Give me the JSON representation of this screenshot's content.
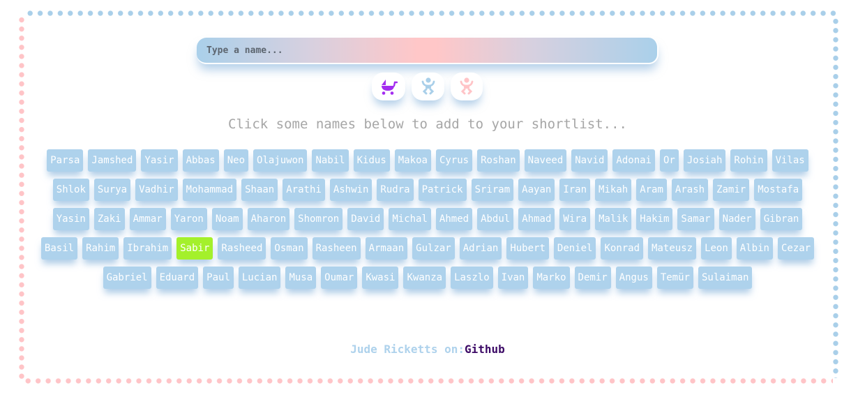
{
  "search": {
    "placeholder": "Type a name...",
    "value": ""
  },
  "gender_filters": [
    {
      "icon": "stroller-icon",
      "label": "All",
      "color": "#a32cf0"
    },
    {
      "icon": "baby-boy-icon",
      "label": "Boy",
      "color": "#a9cfe9"
    },
    {
      "icon": "baby-girl-icon",
      "label": "Girl",
      "color": "#ffc4c7"
    }
  ],
  "hint": "Click some names below to add to your shortlist...",
  "names": [
    "Parsa",
    "Jamshed",
    "Yasir",
    "Abbas",
    "Neo",
    "Olajuwon",
    "Nabil",
    "Kidus",
    "Makoa",
    "Cyrus",
    "Roshan",
    "Naveed",
    "Navid",
    "Adonai",
    "Or",
    "Josiah",
    "Rohin",
    "Vilas",
    "Shlok",
    "Surya",
    "Vadhir",
    "Mohammad",
    "Shaan",
    "Arathi",
    "Ashwin",
    "Rudra",
    "Patrick",
    "Sriram",
    "Aayan",
    "Iran",
    "Mikah",
    "Aram",
    "Arash",
    "Zamir",
    "Mostafa",
    "Yasin",
    "Zaki",
    "Ammar",
    "Yaron",
    "Noam",
    "Aharon",
    "Shomron",
    "David",
    "Michal",
    "Ahmed",
    "Abdul",
    "Ahmad",
    "Wira",
    "Malik",
    "Hakim",
    "Samar",
    "Nader",
    "Gibran",
    "Basil",
    "Rahim",
    "Ibrahim",
    "Sabir",
    "Rasheed",
    "Osman",
    "Rasheen",
    "Armaan",
    "Gulzar",
    "Adrian",
    "Hubert",
    "Deniel",
    "Konrad",
    "Mateusz",
    "Leon",
    "Albin",
    "Cezar",
    "Gabriel",
    "Eduard",
    "Paul",
    "Lucian",
    "Musa",
    "Oumar",
    "Kwasi",
    "Kwanza",
    "Laszlo",
    "Ivan",
    "Marko",
    "Demir",
    "Angus",
    "Temür",
    "Sulaiman"
  ],
  "selected_names": [
    "Sabir"
  ],
  "colors": {
    "name_bg": "#aed2ec",
    "selected_bg": "#a4f02b",
    "border_blue": "#a9cfe9",
    "border_pink": "#ffc4c7"
  },
  "footer": {
    "by": "Jude Ricketts on:",
    "link": "Github"
  }
}
